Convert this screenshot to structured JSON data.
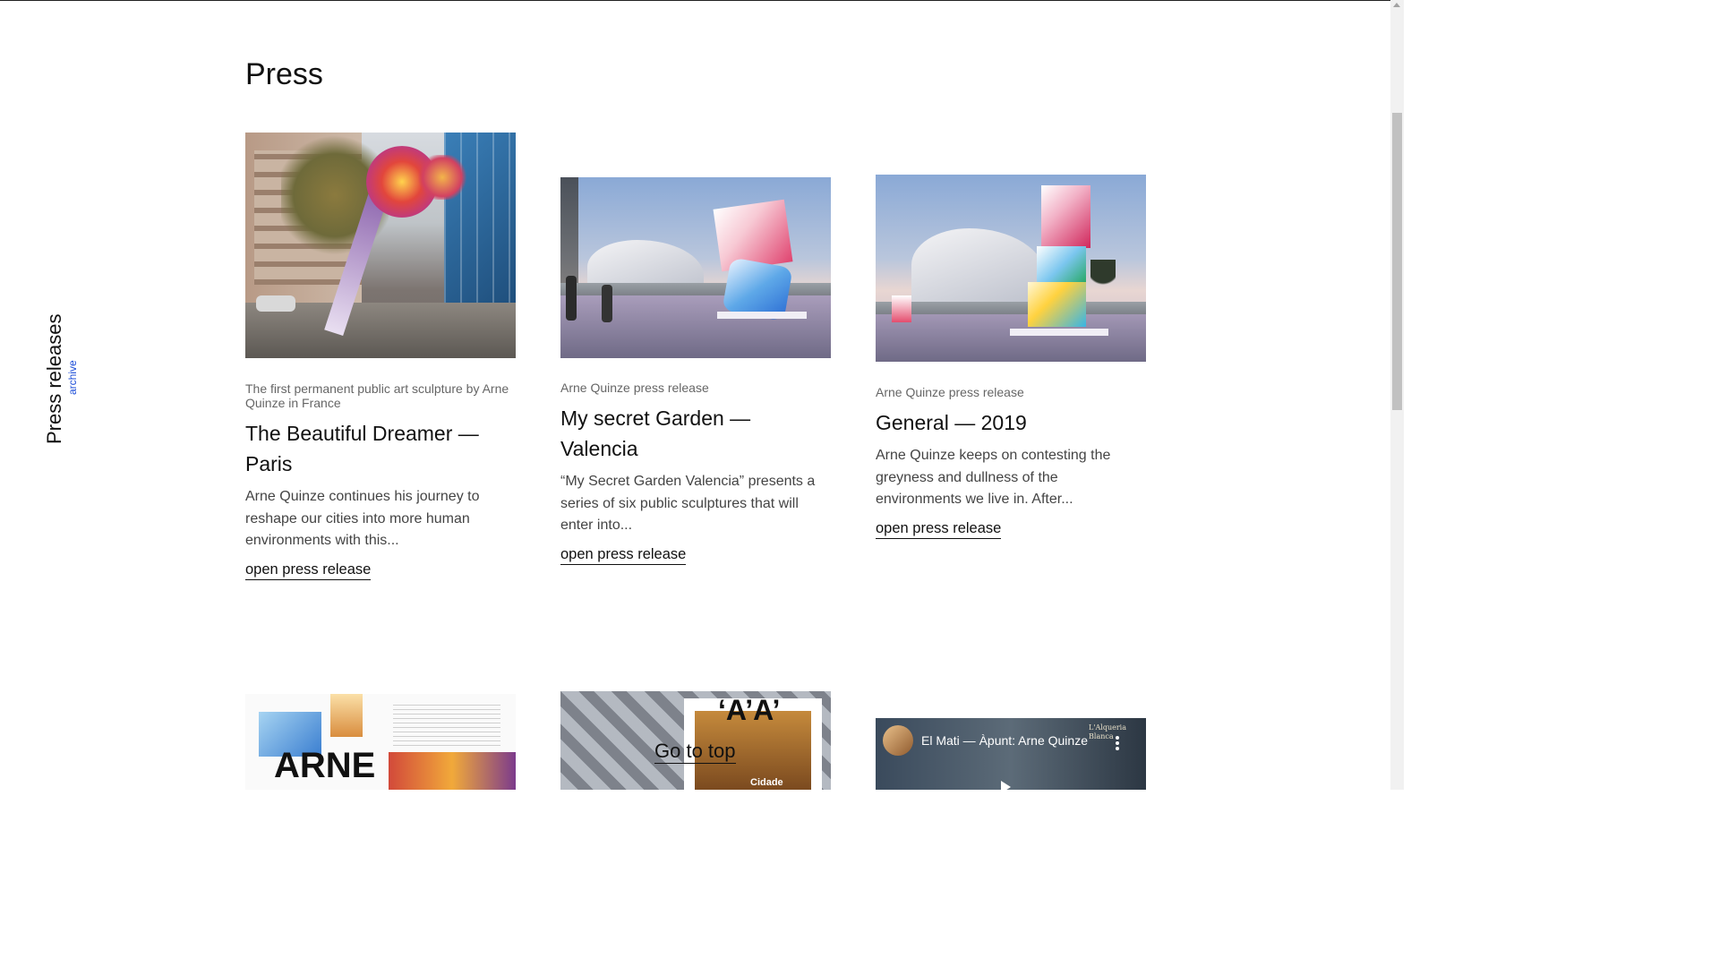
{
  "page": {
    "title": "Press"
  },
  "side_nav": {
    "title": "Press releases",
    "archive_label": "archive"
  },
  "cards": [
    {
      "kicker": "The first permanent public art sculpture by Arne Quinze in France",
      "heading": "The Beautiful Dreamer — Paris",
      "excerpt": "Arne Quinze continues his journey to reshape our cities into more human environments with this...",
      "link": "open press release"
    },
    {
      "kicker": "Arne Quinze press release",
      "heading": "My secret Garden — Valencia",
      "excerpt": "“My Secret Garden Valencia” presents a series of six public sculptures that will enter into...",
      "link": "open press release"
    },
    {
      "kicker": "Arne Quinze press release",
      "heading": "General — 2019",
      "excerpt": "Arne Quinze keeps on contesting the greyness and dullness of the environments we live in. After...",
      "link": "open press release"
    }
  ],
  "bottom_cards": [
    {
      "image_text": "ARNE"
    },
    {
      "image_text": "‘A’A’",
      "image_subtext": "Cidade"
    },
    {
      "video_title": "El Mati — Àpunt: Arne Quinze",
      "video_badge": "L'Alqueria Blanca"
    }
  ],
  "go_to_top": "Go to top",
  "icons": {
    "menu": "more-vert-icon",
    "play": "play-icon"
  }
}
